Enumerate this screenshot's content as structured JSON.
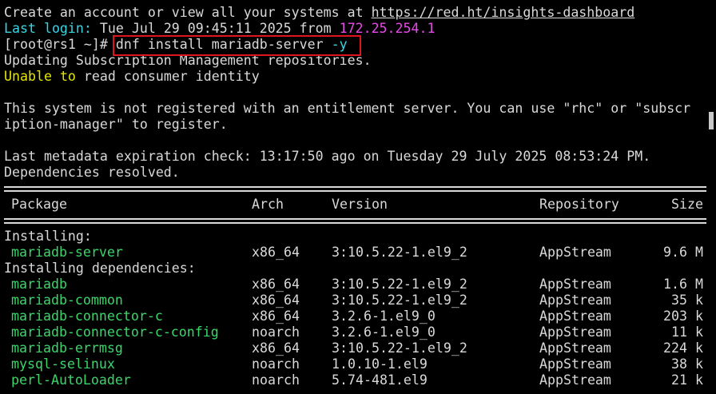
{
  "lines": {
    "l0_text": "Create an account or view all your systems at ",
    "l0_link": "https://red.ht/insights-dashboard",
    "l1_label": "Last login:",
    "l1_text": " Tue Jul 29 09:45:11 2025 from ",
    "l1_ip": "172.25.254.1",
    "l2_prompt": "[root@rs1 ~]# ",
    "l2_cmd": "dnf install mariadb-server ",
    "l2_flag": "-y",
    "l3": "Updating Subscription Management repositories.",
    "l4_unable": "Unable",
    "l4_to": " to",
    "l4_rest": " read consumer identity",
    "l6": "This system is not registered with an entitlement server. You can use \"rhc\" or \"subscr",
    "l7": "iption-manager\" to register.",
    "l9": "Last metadata expiration check: 13:17:50 ago on Tuesday 29 July 2025 08:53:24 PM.",
    "l10": "Dependencies resolved."
  },
  "table": {
    "headers": {
      "package": "Package",
      "arch": "Arch",
      "version": "Version",
      "repository": "Repository",
      "size": "Size"
    },
    "installing_label": "Installing:",
    "installing": [
      {
        "name": "mariadb-server",
        "arch": "x86_64",
        "version": "3:10.5.22-1.el9_2",
        "repo": "AppStream",
        "size": "9.6 M"
      }
    ],
    "deps_label": "Installing dependencies:",
    "dependencies": [
      {
        "name": "mariadb",
        "arch": "x86_64",
        "version": "3:10.5.22-1.el9_2",
        "repo": "AppStream",
        "size": "1.6 M"
      },
      {
        "name": "mariadb-common",
        "arch": "x86_64",
        "version": "3:10.5.22-1.el9_2",
        "repo": "AppStream",
        "size": "35 k"
      },
      {
        "name": "mariadb-connector-c",
        "arch": "x86_64",
        "version": "3.2.6-1.el9_0",
        "repo": "AppStream",
        "size": "203 k"
      },
      {
        "name": "mariadb-connector-c-config",
        "arch": "noarch",
        "version": "3.2.6-1.el9_0",
        "repo": "AppStream",
        "size": "11 k"
      },
      {
        "name": "mariadb-errmsg",
        "arch": "x86_64",
        "version": "3:10.5.22-1.el9_2",
        "repo": "AppStream",
        "size": "224 k"
      },
      {
        "name": "mysql-selinux",
        "arch": "noarch",
        "version": "1.0.10-1.el9",
        "repo": "AppStream",
        "size": "38 k"
      },
      {
        "name": "perl-AutoLoader",
        "arch": "noarch",
        "version": "5.74-481.el9",
        "repo": "AppStream",
        "size": "21 k"
      }
    ]
  },
  "colors": {
    "background": "#000000",
    "text": "#d9d9d9",
    "yellow": "#e6e600",
    "magenta": "#e84ae8",
    "cyan": "#3ad6e6",
    "green": "#3ad66a",
    "highlight_box": "#e0141e"
  }
}
